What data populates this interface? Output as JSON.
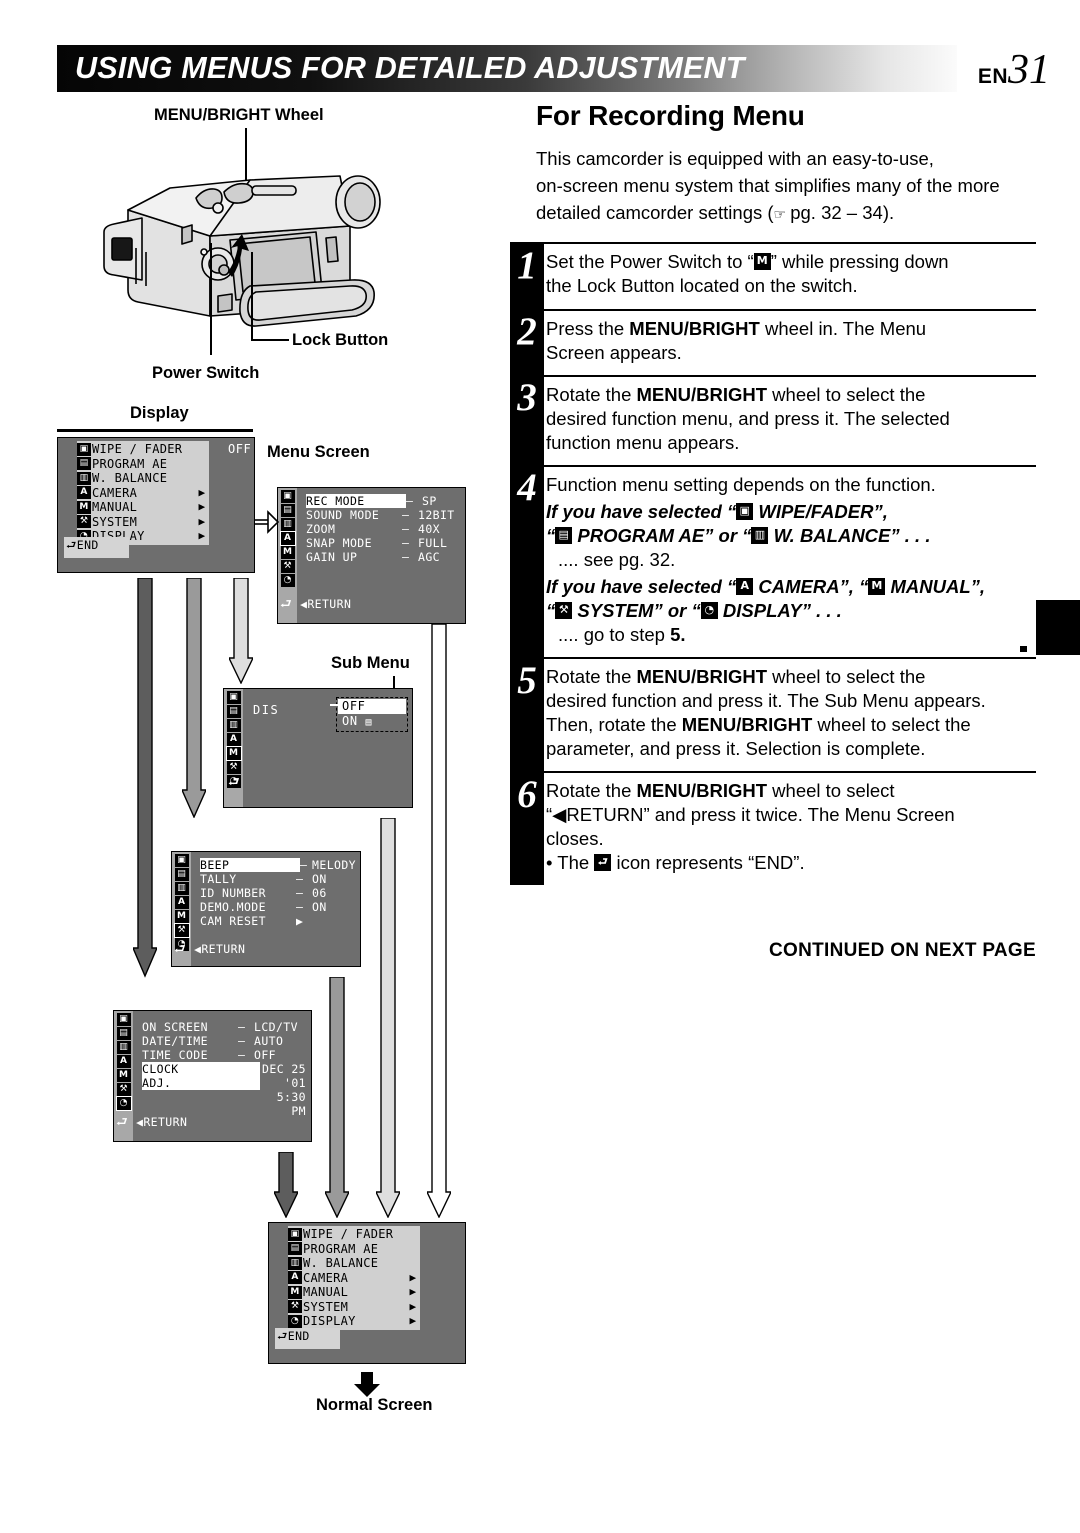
{
  "header": {
    "title": "USING MENUS FOR DETAILED ADJUSTMENT",
    "lang": "EN",
    "page_number": "31"
  },
  "right": {
    "section_title": "For Recording Menu",
    "intro_line1": "This camcorder is equipped with an easy-to-use,",
    "intro_line2": "on-screen menu system that simplifies many of the more",
    "intro_line3a": "detailed camcorder settings (",
    "intro_line3b": " pg. 32 – 34).",
    "steps": [
      {
        "num": "1",
        "line1a": "Set the Power Switch to “",
        "glyph": "M",
        "line1b": "” while pressing down",
        "line2": "the Lock Button located on the switch."
      },
      {
        "num": "2",
        "pre": "Press the ",
        "bold": "MENU/BRIGHT",
        "post": " wheel in. The Menu",
        "line2": "Screen appears."
      },
      {
        "num": "3",
        "pre": "Rotate the ",
        "bold": "MENU/BRIGHT",
        "post": " wheel to select the",
        "line2": "desired function menu, and press it. The selected",
        "line3": "function menu appears."
      },
      {
        "num": "4",
        "line1": "Function menu setting depends on the function.",
        "alt1_a": "If you have selected “",
        "alt1_b": " WIPE/FADER”,",
        "alt1_c": "“",
        "alt1_d": " PROGRAM AE” or “",
        "alt1_e": " W. BALANCE” . . .",
        "alt1_note": ".... see pg. 32.",
        "alt2_a": "If you have selected “",
        "alt2_b": " CAMERA”, “",
        "alt2_c": " MANUAL”,",
        "alt2_d": "“",
        "alt2_e": " SYSTEM” or “",
        "alt2_f": " DISPLAY” . . .",
        "alt2_note_a": ".... go to step ",
        "alt2_note_b": "5."
      },
      {
        "num": "5",
        "pre": "Rotate the ",
        "bold": "MENU/BRIGHT",
        "post": " wheel to select the",
        "line2": "desired function and press it. The Sub Menu appears.",
        "line3a": "Then, rotate the ",
        "line3b": "MENU/BRIGHT",
        "line3c": " wheel to select the",
        "line4": "parameter, and press it. Selection is complete."
      },
      {
        "num": "6",
        "pre": "Rotate the ",
        "bold": "MENU/BRIGHT",
        "post": " wheel to select",
        "line2": "“◀RETURN” and press it twice. The Menu Screen",
        "line3": "closes.",
        "bullet_a": "• The ",
        "bullet_b": " icon represents “END”."
      }
    ],
    "continued": "CONTINUED ON NEXT PAGE"
  },
  "left": {
    "labels": {
      "menu_bright_wheel": "MENU/BRIGHT Wheel",
      "lock_button": "Lock Button",
      "power_switch": "Power Switch",
      "display": "Display",
      "menu_screen": "Menu Screen",
      "sub_menu": "Sub Menu",
      "normal_screen": "Normal Screen"
    },
    "panels": {
      "main_menu_top": {
        "items": [
          {
            "icon": "wipe",
            "label": "WIPE / FADER",
            "chevron": ""
          },
          {
            "icon": "program",
            "label": "PROGRAM  AE",
            "chevron": ""
          },
          {
            "icon": "wbalance",
            "label": "W. BALANCE",
            "chevron": ""
          },
          {
            "icon": "A",
            "label": "CAMERA",
            "chevron": "▶"
          },
          {
            "icon": "M",
            "label": "MANUAL",
            "chevron": "▶"
          },
          {
            "icon": "system",
            "label": "SYSTEM",
            "chevron": "▶"
          },
          {
            "icon": "clock",
            "label": "DISPLAY",
            "chevron": "▶"
          }
        ],
        "value_right": "OFF",
        "end_label": "END"
      },
      "camera_menu": {
        "rows": [
          {
            "name": "REC MODE",
            "dash": "–",
            "value": "SP",
            "highlight": true
          },
          {
            "name": "SOUND MODE",
            "dash": "–",
            "value": "12BIT",
            "highlight": false
          },
          {
            "name": "ZOOM",
            "dash": "–",
            "value": "40X",
            "highlight": false
          },
          {
            "name": "SNAP MODE",
            "dash": "–",
            "value": "FULL",
            "highlight": false
          },
          {
            "name": "GAIN UP",
            "dash": "–",
            "value": "AGC",
            "highlight": false
          }
        ],
        "return_label": "◀RETURN",
        "selected_rail": "A"
      },
      "sub_menu": {
        "title": "DIS",
        "option_off": "OFF",
        "option_on": "ON",
        "selected_rail": "M"
      },
      "system_menu": {
        "rows": [
          {
            "name": "BEEP",
            "dash": "–",
            "value": "MELODY",
            "highlight": true
          },
          {
            "name": "TALLY",
            "dash": "–",
            "value": "ON",
            "highlight": false
          },
          {
            "name": " ID NUMBER",
            "dash": "–",
            "value": "06",
            "highlight": false
          },
          {
            "name": "DEMO.MODE",
            "dash": "–",
            "value": "ON",
            "highlight": false
          },
          {
            "name": "CAM RESET",
            "dash": "▶",
            "value": "",
            "highlight": false
          }
        ],
        "return_label": "◀RETURN",
        "selected_rail": "system"
      },
      "display_menu": {
        "rows": [
          {
            "name": "ON SCREEN",
            "dash": "–",
            "value": "LCD/TV",
            "highlight": false
          },
          {
            "name": "DATE/TIME",
            "dash": "–",
            "value": "AUTO",
            "highlight": false
          },
          {
            "name": "TIME CODE",
            "dash": "–",
            "value": "OFF",
            "highlight": false
          }
        ],
        "clock_label_1": "CLOCK",
        "clock_label_2": " ADJ.",
        "clock_value_1": "DEC 25 '01",
        "clock_value_2": "5:30 PM",
        "return_label": "◀RETURN",
        "selected_rail": "clock"
      },
      "main_menu_bottom": {
        "items": [
          {
            "icon": "wipe",
            "label": "WIPE / FADER",
            "chevron": ""
          },
          {
            "icon": "program",
            "label": "PROGRAM  AE",
            "chevron": ""
          },
          {
            "icon": "wbalance",
            "label": "W. BALANCE",
            "chevron": ""
          },
          {
            "icon": "A",
            "label": "CAMERA",
            "chevron": "▶"
          },
          {
            "icon": "M",
            "label": "MANUAL",
            "chevron": "▶"
          },
          {
            "icon": "system",
            "label": "SYSTEM",
            "chevron": "▶"
          },
          {
            "icon": "clock",
            "label": "DISPLAY",
            "chevron": "▶"
          }
        ],
        "end_label": "END"
      }
    }
  }
}
